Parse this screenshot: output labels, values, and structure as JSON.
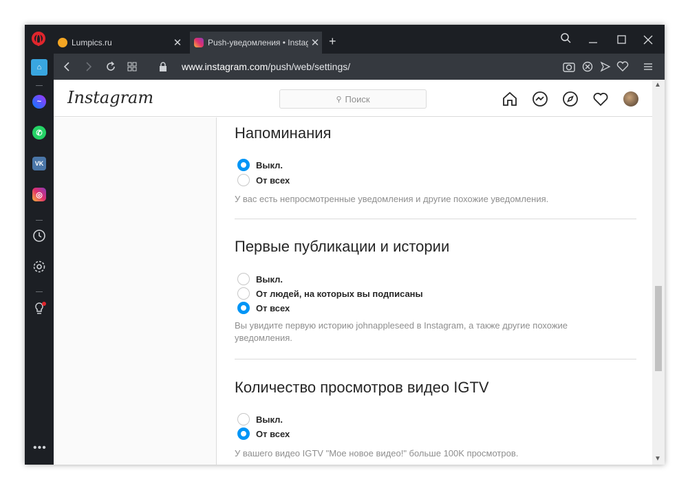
{
  "browser": {
    "tabs": [
      {
        "title": "Lumpics.ru",
        "active": false
      },
      {
        "title": "Push-уведомления • Instagram",
        "active": true
      }
    ],
    "url_host": "www.instagram.com",
    "url_path": "/push/web/settings/"
  },
  "instagram": {
    "logo": "Instagram",
    "search_placeholder": "Поиск"
  },
  "sections": [
    {
      "title": "Напоминания",
      "options": [
        {
          "label": "Выкл.",
          "selected": true
        },
        {
          "label": "От всех",
          "selected": false
        }
      ],
      "description": "У вас есть непросмотренные уведомления и другие похожие уведомления."
    },
    {
      "title": "Первые публикации и истории",
      "options": [
        {
          "label": "Выкл.",
          "selected": false
        },
        {
          "label": "От людей, на которых вы подписаны",
          "selected": false
        },
        {
          "label": "От всех",
          "selected": true
        }
      ],
      "description": "Вы увидите первую историю johnappleseed в Instagram, а также другие похожие уведомления."
    },
    {
      "title": "Количество просмотров видео IGTV",
      "options": [
        {
          "label": "Выкл.",
          "selected": false
        },
        {
          "label": "От всех",
          "selected": true
        }
      ],
      "description": "У вашего видео IGTV \"Мое новое видео!\" больше 100K просмотров."
    }
  ],
  "colors": {
    "accent": "#0095f6",
    "chrome": "#1c1f24"
  }
}
